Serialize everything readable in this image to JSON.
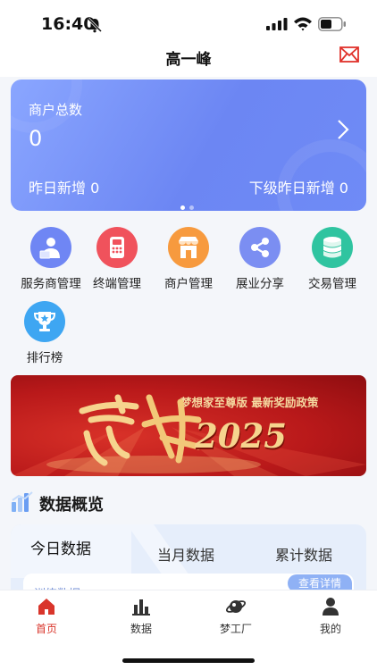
{
  "status_bar": {
    "time": "16:40"
  },
  "header": {
    "title": "高一峰"
  },
  "summary_card": {
    "title": "商户总数",
    "count": "0",
    "yesterday_new": "昨日新增 0",
    "sub_yesterday_new": "下级昨日新增 0",
    "page_count": 2,
    "active_page": 1
  },
  "menu": [
    {
      "label": "服务商管理",
      "icon": "service-provider-icon",
      "color": "#6f86f4"
    },
    {
      "label": "终端管理",
      "icon": "pos-terminal-icon",
      "color": "#f0525c"
    },
    {
      "label": "商户管理",
      "icon": "store-icon",
      "color": "#f79a3e"
    },
    {
      "label": "展业分享",
      "icon": "share-icon",
      "color": "#7b8ef2"
    },
    {
      "label": "交易管理",
      "icon": "coins-icon",
      "color": "#2fc4a0"
    },
    {
      "label": "排行榜",
      "icon": "trophy-icon",
      "color": "#3ea6f2"
    }
  ],
  "banner": {
    "subtitle": "梦想家至尊版 最新奖励政策",
    "title": "赢战",
    "year": "2025"
  },
  "data_overview": {
    "title": "数据概览",
    "tabs": [
      "今日数据",
      "当月数据",
      "累计数据"
    ],
    "active_tab": 0,
    "detail_button": "查看详情",
    "row_label": "训练数据"
  },
  "tab_bar": {
    "items": [
      {
        "label": "首页",
        "icon": "home-icon",
        "active": true
      },
      {
        "label": "数据",
        "icon": "bar-chart-icon",
        "active": false
      },
      {
        "label": "梦工厂",
        "icon": "planet-icon",
        "active": false
      },
      {
        "label": "我的",
        "icon": "profile-icon",
        "active": false
      }
    ]
  },
  "colors": {
    "accent": "#d9352b",
    "card": "#6f8bf6",
    "banner": "#b9191a"
  }
}
